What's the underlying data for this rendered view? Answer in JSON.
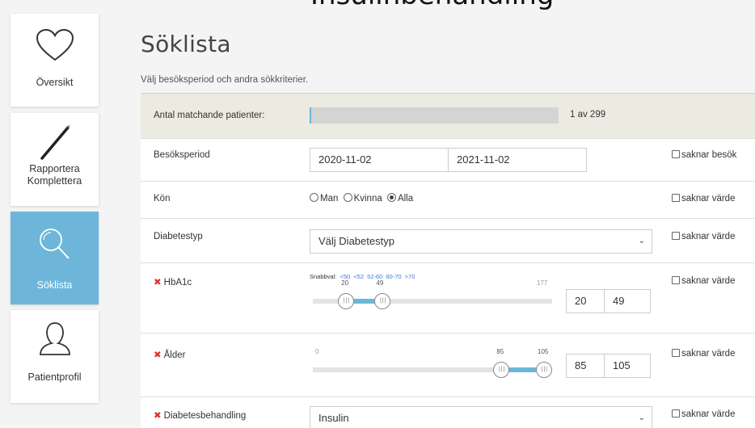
{
  "top_title": "Insulinbehandling",
  "sidebar": {
    "items": [
      {
        "label": "Översikt",
        "icon": "heart-icon",
        "active": false
      },
      {
        "label": "Rapportera",
        "label2": "Komplettera",
        "icon": "pen-icon",
        "active": false
      },
      {
        "label": "Söklista",
        "icon": "search-icon",
        "active": true
      },
      {
        "label": "Patientprofil",
        "icon": "user-icon",
        "active": false
      }
    ]
  },
  "main": {
    "heading": "Söklista",
    "subheading": "Välj besöksperiod och andra sökkriterier.",
    "matching": {
      "label": "Antal matchande patienter:",
      "count": "1 av 299",
      "fraction": 0.0033
    },
    "visit_period": {
      "label": "Besöksperiod",
      "from": "2020-11-02",
      "to": "2021-11-02",
      "missing": "saknar besök"
    },
    "gender": {
      "label": "Kön",
      "options": [
        "Man",
        "Kvinna",
        "Alla"
      ],
      "selected": "Alla",
      "missing": "saknar värde"
    },
    "diabetes_type": {
      "label": "Diabetestyp",
      "value": "Välj Diabetestyp",
      "missing": "saknar värde"
    },
    "hba1c": {
      "label": "HbA1c",
      "quick_prefix": "Snabbval:",
      "quick_options": [
        "<50",
        "<52",
        "52-60",
        "60-70",
        ">70"
      ],
      "min": 0,
      "max": 177,
      "low": 20,
      "high": 49,
      "low_label": "20",
      "high_label": "49",
      "max_label": "177",
      "low_input": "20",
      "high_input": "49",
      "missing": "saknar värde"
    },
    "age": {
      "label": "Ålder",
      "min": 0,
      "max": 105,
      "low": 85,
      "high": 105,
      "min_label": "0",
      "low_label": "85",
      "high_label": "105",
      "low_input": "85",
      "high_input": "105",
      "missing": "saknar värde"
    },
    "treatment": {
      "label": "Diabetesbehandling",
      "value": "Insulin",
      "missing": "saknar värde"
    }
  },
  "colors": {
    "accent": "#6db6da",
    "remove": "#d33333",
    "link": "#3a7bd5"
  }
}
